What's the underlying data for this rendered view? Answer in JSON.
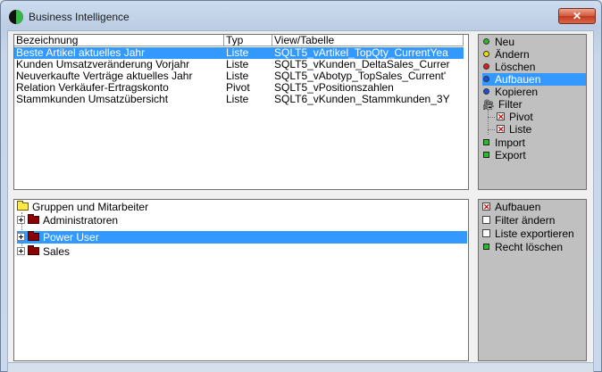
{
  "window": {
    "title": "Business Intelligence",
    "close_label": "✕"
  },
  "reports": {
    "columns": [
      "Bezeichnung",
      "Typ",
      "View/Tabelle"
    ],
    "rows": [
      {
        "name": "Beste Artikel aktuelles Jahr",
        "type": "Liste",
        "view": "SQLT5_vArtikel_TopQty_CurrentYea",
        "selected": true
      },
      {
        "name": "Kunden Umsatzveränderung Vorjahr",
        "type": "Liste",
        "view": "SQLT5_vKunden_DeltaSales_Currer"
      },
      {
        "name": "Neuverkaufte Verträge aktuelles Jahr",
        "type": "Liste",
        "view": "SQLT5_vAbotyp_TopSales_Current'"
      },
      {
        "name": "Relation Verkäufer-Ertragskonto",
        "type": "Pivot",
        "view": "SQLT5_vPositionszahlen"
      },
      {
        "name": "Stammkunden Umsatzübersicht",
        "type": "Liste",
        "view": "SQLT6_vKunden_Stammkunden_3Y"
      }
    ]
  },
  "actions": {
    "neu": "Neu",
    "aendern": "Ändern",
    "loeschen": "Löschen",
    "aufbauen": "Aufbauen",
    "kopieren": "Kopieren",
    "filter": "Filter",
    "pivot": "Pivot",
    "liste": "Liste",
    "import": "Import",
    "export": "Export"
  },
  "groups": {
    "root": "Gruppen und Mitarbeiter",
    "items": [
      "Administratoren",
      "Power User",
      "Sales"
    ]
  },
  "rights": {
    "aufbauen": "Aufbauen",
    "filter_aendern": "Filter ändern",
    "liste_exportieren": "Liste exportieren",
    "recht_loeschen": "Recht löschen"
  },
  "colors": {
    "selection": "#3399ff",
    "green": "#2eb82e",
    "yellow": "#f0e000",
    "red": "#e02020",
    "blue": "#1f4fd8"
  }
}
